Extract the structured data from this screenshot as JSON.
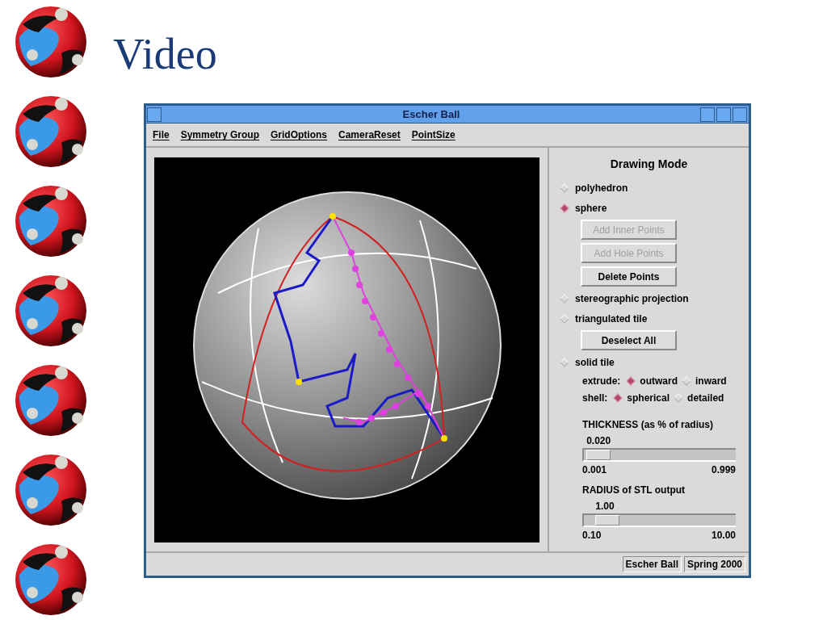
{
  "slide": {
    "title": "Video"
  },
  "window": {
    "title": "Escher Ball"
  },
  "menu": [
    {
      "label": "File"
    },
    {
      "label": "Symmetry Group"
    },
    {
      "label": "GridOptions"
    },
    {
      "label": "CameraReset"
    },
    {
      "label": "PointSize"
    }
  ],
  "panel": {
    "heading": "Drawing Mode",
    "items": [
      {
        "kind": "radio",
        "label": "polyhedron",
        "selected": false
      },
      {
        "kind": "radio",
        "label": "sphere",
        "selected": true
      },
      {
        "kind": "button",
        "label": "Add Inner Points",
        "disabled": true
      },
      {
        "kind": "button",
        "label": "Add Hole Points",
        "disabled": true
      },
      {
        "kind": "button",
        "label": "Delete Points",
        "disabled": false
      },
      {
        "kind": "radio",
        "label": "stereographic projection",
        "selected": false
      },
      {
        "kind": "radio",
        "label": "triangulated tile",
        "selected": false
      },
      {
        "kind": "button",
        "label": "Deselect All",
        "disabled": false
      },
      {
        "kind": "radio",
        "label": "solid tile",
        "selected": false
      }
    ],
    "options": [
      {
        "label": "extrude:",
        "choices": [
          {
            "label": "outward",
            "selected": true
          },
          {
            "label": "inward",
            "selected": false
          }
        ]
      },
      {
        "label": "shell:",
        "choices": [
          {
            "label": "spherical",
            "selected": true
          },
          {
            "label": "detailed",
            "selected": false
          }
        ]
      }
    ],
    "sliders": [
      {
        "label": "THICKNESS (as % of radius)",
        "reading": "0.020",
        "level": 0.02,
        "min": "0.001",
        "max": "0.999"
      },
      {
        "label": "RADIUS of STL output",
        "reading": "1.00",
        "level": 0.09,
        "min": "0.10",
        "max": "10.00"
      }
    ]
  },
  "status_bar": [
    "Escher Ball",
    "Spring 2000"
  ]
}
